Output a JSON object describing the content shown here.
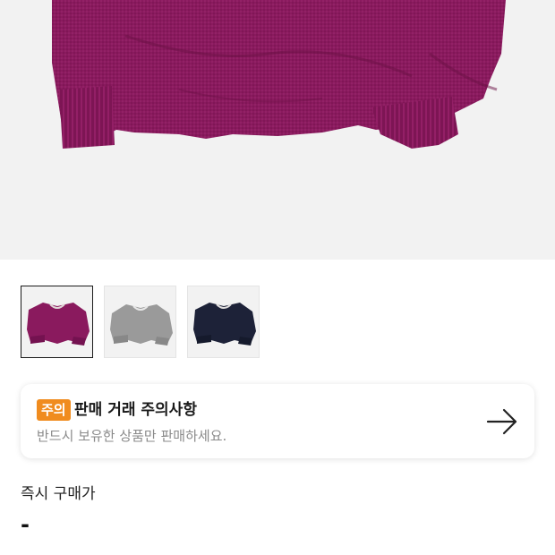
{
  "product": {
    "images": [
      {
        "icon": "purple-sweater-image",
        "color": "#8a1a5e",
        "selected": true
      },
      {
        "icon": "gray-sweater-image",
        "color": "#9a9a9a",
        "selected": false
      },
      {
        "icon": "navy-sweater-image",
        "color": "#1d2238",
        "selected": false
      }
    ]
  },
  "notice": {
    "badge": "주의",
    "title": "판매 거래 주의사항",
    "subtitle": "반드시 보유한 상품만 판매하세요.",
    "badge_color": "#f08c1f",
    "icon": "arrow-right-icon"
  },
  "price": {
    "label": "즉시 구매가",
    "value": "-"
  }
}
